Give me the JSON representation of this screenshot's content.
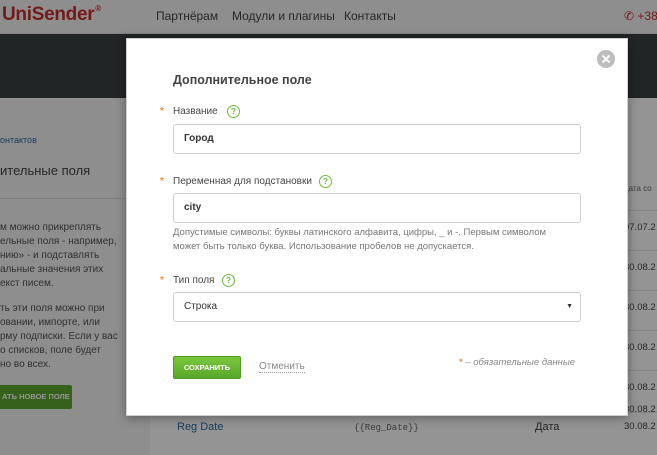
{
  "page": {
    "logo": "UniSender",
    "logo_mark": "®",
    "nav": [
      "Партнёрам",
      "Модули и плагины",
      "Контакты"
    ],
    "phone": "+380",
    "breadcrumb": "онтактов",
    "left_title": "ительные поля",
    "paragraph1": [
      "м можно прикреплять",
      "ельные поля - например,",
      "нию» - и подставлять",
      "альные значения этих",
      "екст писем."
    ],
    "paragraph2": [
      "ть эти поля можно при",
      "овании, импорте, или",
      "рму подписки. Если у вас",
      "о списков, поле будет",
      "но во всех."
    ],
    "add_button": "АТЬ НОВОЕ ПОЛЕ",
    "date_header": "дата со",
    "dates": [
      "07.07.2",
      "30.08.2",
      "30.08.2",
      "30.08.2",
      "30.08.2",
      "30.08.2",
      "30.08.2"
    ],
    "table_row": {
      "name": "Reg Date",
      "variable": "{{Reg_Date}}",
      "type": "Дата",
      "date": "30.08.2"
    }
  },
  "modal": {
    "title": "Дополнительное поле",
    "required_mark": "*",
    "help_icon": "?",
    "fields": {
      "name": {
        "label": "Название",
        "value": "Город"
      },
      "variable": {
        "label": "Переменная для подстановки",
        "value": "city"
      },
      "type": {
        "label": "Тип поля",
        "selected": "Строка",
        "arrow": "▼"
      }
    },
    "hint": [
      "Допустимые символы: буквы латинского алфавита, цифры, _ и -. Первым символом",
      "может быть только буква. Использование пробелов не допускается."
    ],
    "save_label": "СОХРАНИТЬ",
    "cancel_label": "Отменить",
    "required_note": "– обязательные данные"
  },
  "icons": {
    "close": "close-icon",
    "help": "question-circle-icon",
    "dropdown": "chevron-down-icon"
  },
  "colors": {
    "accent_green": "#5da72e",
    "brand_red": "#c9302c",
    "required_orange": "#f0932b",
    "link_blue": "#2b6ea3"
  }
}
